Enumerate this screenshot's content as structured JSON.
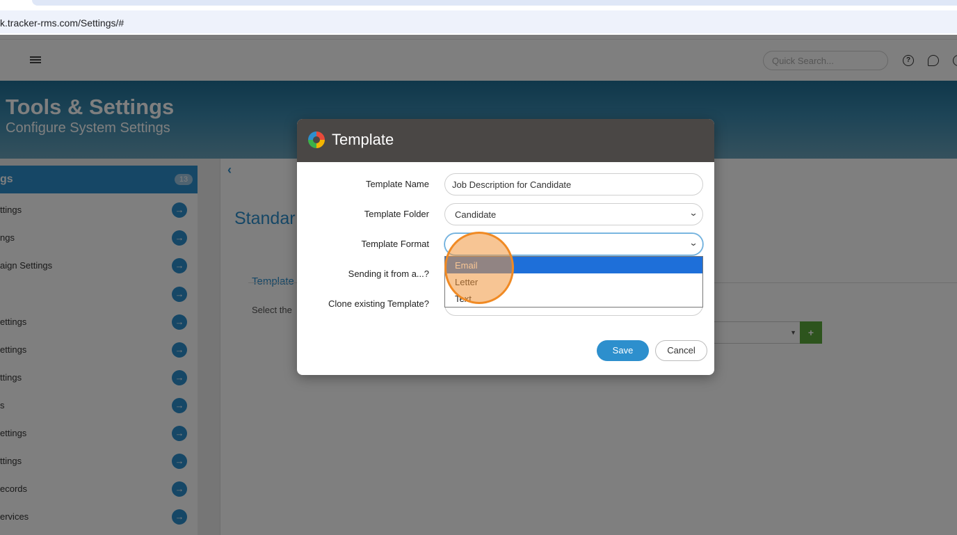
{
  "browser": {
    "url": "k.tracker-rms.com/Settings/#"
  },
  "header": {
    "search_placeholder": "Quick Search...",
    "icons": [
      "hamburger-icon",
      "help-icon",
      "chat-icon",
      "user-icon"
    ]
  },
  "banner": {
    "title": "Tools & Settings",
    "subtitle": "Configure System Settings"
  },
  "sidebar": {
    "head": {
      "label": "gs",
      "badge": "13"
    },
    "items": [
      {
        "label": "ttings"
      },
      {
        "label": "ngs"
      },
      {
        "label": "aign Settings"
      },
      {
        "label": ""
      },
      {
        "label": "ettings"
      },
      {
        "label": "ettings"
      },
      {
        "label": "ttings"
      },
      {
        "label": "s"
      },
      {
        "label": "ettings"
      },
      {
        "label": "ttings"
      },
      {
        "label": "ecords"
      },
      {
        "label": "ervices"
      }
    ]
  },
  "main": {
    "title": "Standar",
    "tab_link": "Template",
    "select_text": "Select the",
    "add_label": "+"
  },
  "modal": {
    "title": "Template",
    "fields": {
      "template_name": {
        "label": "Template Name",
        "value": "Job Description for Candidate"
      },
      "template_folder": {
        "label": "Template Folder",
        "value": "Candidate"
      },
      "template_format": {
        "label": "Template Format",
        "value": ""
      },
      "sending_from": {
        "label": "Sending it from a...?"
      },
      "clone_existing": {
        "label": "Clone existing Template?"
      }
    },
    "format_options": [
      "Email",
      "Letter",
      "Text"
    ],
    "selected_option": "Email",
    "save_label": "Save",
    "cancel_label": "Cancel"
  },
  "colors": {
    "accent": "#2d8fcd",
    "modal_header": "#4a4745",
    "highlight": "#1e6fd9",
    "click_marker": "#f08a24"
  }
}
